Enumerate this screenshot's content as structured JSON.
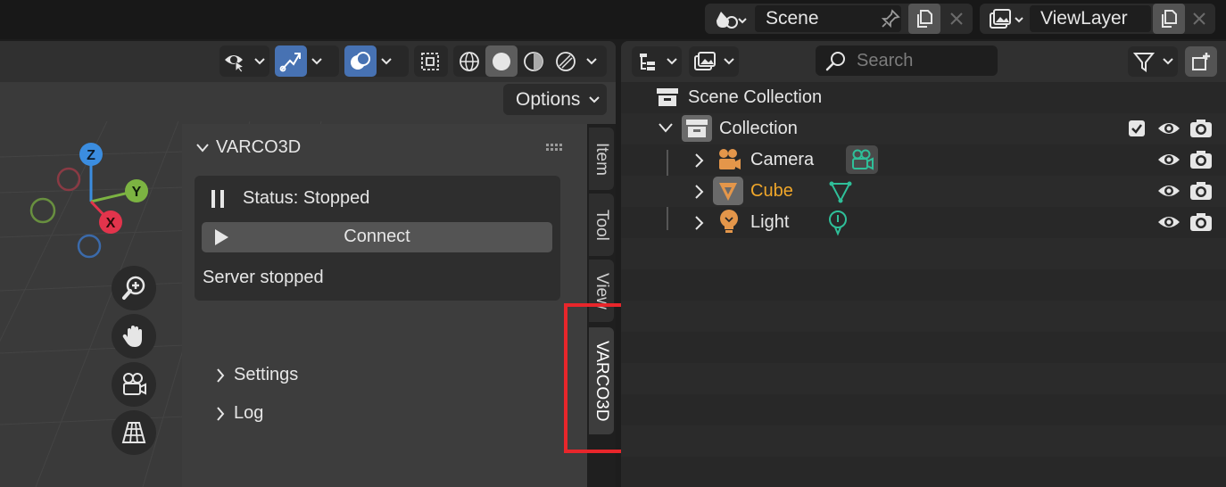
{
  "topbar": {
    "scene_name": "Scene",
    "view_layer_name": "ViewLayer"
  },
  "viewport": {
    "options_label": "Options",
    "gizmo": {
      "x": "X",
      "y": "Y",
      "z": "Z"
    },
    "panel": {
      "title": "VARCO3D",
      "status": "Status: Stopped",
      "connect_label": "Connect",
      "server_message": "Server stopped",
      "subpanels": [
        "Settings",
        "Log"
      ]
    },
    "tabs": [
      "Item",
      "Tool",
      "View",
      "VARCO3D"
    ]
  },
  "outliner": {
    "search_placeholder": "Search",
    "scene_collection": "Scene Collection",
    "collection": "Collection",
    "items": [
      {
        "name": "Camera",
        "color": "#e6e6e6",
        "data_icon": "camera-data-icon"
      },
      {
        "name": "Cube",
        "color": "#f0a72a",
        "data_icon": "mesh-data-icon"
      },
      {
        "name": "Light",
        "color": "#e6e6e6",
        "data_icon": "light-data-icon"
      }
    ]
  },
  "colors": {
    "accent": "#4772b3",
    "highlight": "#e8262b",
    "data_icon": "#2fbf99",
    "object_icon": "#e4964a"
  }
}
